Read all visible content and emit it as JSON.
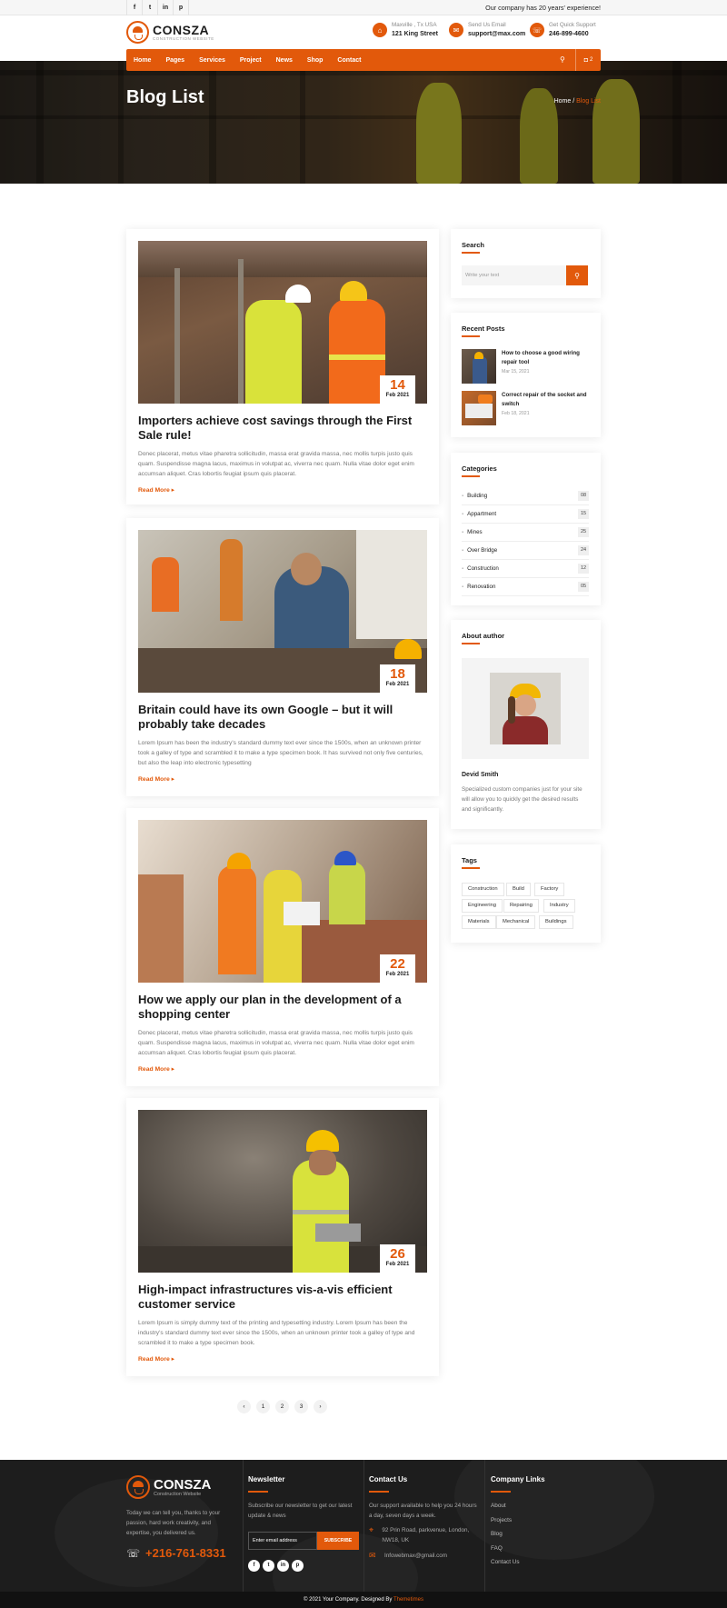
{
  "topbar": {
    "social": [
      "f",
      "t",
      "in",
      "p"
    ],
    "experience": "Our company has 20 years' experience!"
  },
  "brand": {
    "name": "CONSZA",
    "tagline": "CONSTRUCTION WEBSITE"
  },
  "header_contacts": [
    {
      "icon": "location-pin-icon",
      "label": "Maxville , Tx USA",
      "value": "121 King Street"
    },
    {
      "icon": "mail-icon",
      "label": "Send Us Email",
      "value": "support@max.com"
    },
    {
      "icon": "phone-icon",
      "label": "Get Quick Support",
      "value": "246-899-4600"
    }
  ],
  "nav": {
    "items": [
      "Home",
      "Pages",
      "Services",
      "Project",
      "News",
      "Shop",
      "Contact"
    ],
    "cart_count": "2"
  },
  "hero": {
    "title": "Blog List",
    "crumb_home": "Home",
    "crumb_sep": "/",
    "crumb_current": "Blog List"
  },
  "posts": [
    {
      "day": "14",
      "month": "Feb 2021",
      "title": "Importers achieve cost savings through the First Sale rule!",
      "excerpt": "Donec placerat, metus vitae pharetra sollicitudin, massa erat gravida massa, nec mollis turpis justo quis quam. Suspendisse magna lacus, maximus in volutpat ac, viverra nec quam. Nulla vitae dolor eget enim accumsan aliquet. Cras lobortis feugiat ipsum quis placerat.",
      "read_more": "Read More ▸"
    },
    {
      "day": "18",
      "month": "Feb 2021",
      "title": "Britain could have its own Google – but it will probably take decades",
      "excerpt": "Lorem Ipsum has been the industry's standard dummy text ever since the 1500s, when an unknown printer took a galley of type and scrambled it to make a type specimen book. It has survived not only five centuries, but also the leap into electronic typesetting",
      "read_more": "Read More ▸"
    },
    {
      "day": "22",
      "month": "Feb 2021",
      "title": "How we apply our plan in the development of a shopping center",
      "excerpt": "Donec placerat, metus vitae pharetra sollicitudin, massa erat gravida massa, nec mollis turpis justo quis quam. Suspendisse magna lacus, maximus in volutpat ac, viverra nec quam. Nulla vitae dolor eget enim accumsan aliquet. Cras lobortis feugiat ipsum quis placerat.",
      "read_more": "Read More ▸"
    },
    {
      "day": "26",
      "month": "Feb 2021",
      "title": "High-impact infrastructures vis-a-vis efficient customer service",
      "excerpt": "Lorem Ipsum is simply dummy text of the printing and typesetting industry. Lorem Ipsum has been the industry's standard dummy text ever since the 1500s, when an unknown printer took a galley of type and scrambled it to make a type specimen book.",
      "read_more": "Read More ▸"
    }
  ],
  "sidebar": {
    "search": {
      "title": "Search",
      "placeholder": "Write your text"
    },
    "recent": {
      "title": "Recent Posts",
      "items": [
        {
          "title": "How to choose a good wiring repair tool",
          "date": "Mar 15, 2021"
        },
        {
          "title": "Correct repair of the socket and switch",
          "date": "Feb 18, 2021"
        }
      ]
    },
    "categories": {
      "title": "Categories",
      "items": [
        {
          "name": "Building",
          "count": "08"
        },
        {
          "name": "Appartment",
          "count": "15"
        },
        {
          "name": "Mines",
          "count": "25"
        },
        {
          "name": "Over Bridge",
          "count": "24"
        },
        {
          "name": "Construction",
          "count": "12"
        },
        {
          "name": "Renovation",
          "count": "05"
        }
      ]
    },
    "about": {
      "title": "About author",
      "name": "Devid Smith",
      "text": "Specialized custom companies just for your site will allow you to quickly get the desired results and significantly."
    },
    "tags": {
      "title": "Tags",
      "items": [
        "Construction",
        "Build",
        "Factory",
        "Engineering",
        "Repairing",
        "Industry",
        "Materials",
        "Mechanical",
        "Buildings"
      ]
    }
  },
  "pagination": [
    "‹",
    "1",
    "2",
    "3",
    "›"
  ],
  "footer": {
    "brand_name": "CONSZA",
    "brand_tagline": "Construction Website",
    "about": "Today we can tell you, thanks to your passion, hard work creativity, and expertise, you delivered us.",
    "phone": "+216-761-8331",
    "newsletter": {
      "title": "Newsletter",
      "text": "Subscribe our newsletter to get our latest update & news",
      "placeholder": "Enter email address",
      "button": "SUBSCRIBE"
    },
    "social": [
      "f",
      "t",
      "in",
      "p"
    ],
    "contact": {
      "title": "Contact Us",
      "text": "Our support available to help you 24 hours a day, seven days a week.",
      "address": "92 Prin Road, parkvenue, London, NW18, UK",
      "email": "Infowebmax@gmail.com"
    },
    "links": {
      "title": "Company Links",
      "items": [
        "About",
        "Projects",
        "Blog",
        "FAQ",
        "Contact Us"
      ]
    },
    "copyright": "© 2021 Your Company. Designed By",
    "designer": "Themetimes"
  },
  "colors": {
    "accent": "#e2590b",
    "dark": "#1d1d1d"
  }
}
